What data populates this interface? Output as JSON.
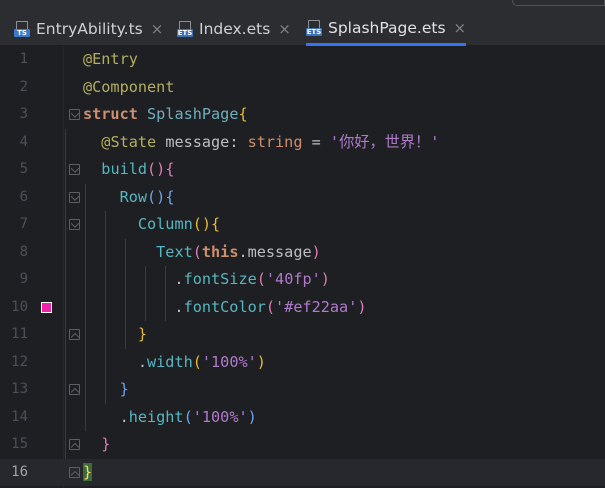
{
  "tabs": [
    {
      "label": "EntryAbility.ts",
      "badge": "TS",
      "badge_class": "ts",
      "active": false
    },
    {
      "label": "Index.ets",
      "badge": "ETS",
      "badge_class": "ets",
      "active": false
    },
    {
      "label": "SplashPage.ets",
      "badge": "ETS",
      "badge_class": "ets",
      "active": true
    }
  ],
  "close_glyph": "×",
  "editor": {
    "current_line": 16,
    "font_color_swatch": "#ef22aa",
    "lines": [
      {
        "n": "1",
        "tokens": [
          [
            "deco",
            "@Entry"
          ]
        ]
      },
      {
        "n": "2",
        "tokens": [
          [
            "deco",
            "@Component"
          ]
        ]
      },
      {
        "n": "3",
        "tokens": [
          [
            "kw",
            "struct"
          ],
          [
            "",
            " "
          ],
          [
            "cls",
            "SplashPage"
          ],
          [
            "br",
            "{"
          ]
        ]
      },
      {
        "n": "4",
        "tokens": [
          [
            "",
            "  "
          ],
          [
            "deco",
            "@State"
          ],
          [
            "",
            " message: "
          ],
          [
            "typ",
            "string"
          ],
          [
            "",
            " = "
          ],
          [
            "str",
            "'你好，世界！'"
          ]
        ]
      },
      {
        "n": "5",
        "tokens": [
          [
            "",
            "  "
          ],
          [
            "fn",
            "build"
          ],
          [
            "br2",
            "()"
          ],
          [
            "br2",
            "{"
          ]
        ]
      },
      {
        "n": "6",
        "tokens": [
          [
            "",
            "    "
          ],
          [
            "fn",
            "Row"
          ],
          [
            "br4",
            "()"
          ],
          [
            "br4",
            "{"
          ]
        ]
      },
      {
        "n": "7",
        "tokens": [
          [
            "",
            "      "
          ],
          [
            "fn",
            "Column"
          ],
          [
            "br",
            "()"
          ],
          [
            "br",
            "{"
          ]
        ]
      },
      {
        "n": "8",
        "tokens": [
          [
            "",
            "        "
          ],
          [
            "fn",
            "Text"
          ],
          [
            "br2",
            "("
          ],
          [
            "kw",
            "this"
          ],
          [
            "",
            ".message"
          ],
          [
            "br2",
            ")"
          ]
        ]
      },
      {
        "n": "9",
        "tokens": [
          [
            "",
            "          ."
          ],
          [
            "fn",
            "fontSize"
          ],
          [
            "br2",
            "("
          ],
          [
            "str",
            "'40fp'"
          ],
          [
            "br2",
            ")"
          ]
        ]
      },
      {
        "n": "10",
        "tokens": [
          [
            "",
            "          ."
          ],
          [
            "fn",
            "fontColor"
          ],
          [
            "br2",
            "("
          ],
          [
            "str",
            "'#ef22aa'"
          ],
          [
            "br2",
            ")"
          ]
        ]
      },
      {
        "n": "11",
        "tokens": [
          [
            "",
            "      "
          ],
          [
            "br",
            "}"
          ]
        ]
      },
      {
        "n": "12",
        "tokens": [
          [
            "",
            "      ."
          ],
          [
            "fn",
            "width"
          ],
          [
            "br",
            "("
          ],
          [
            "str",
            "'100%'"
          ],
          [
            "br",
            ")"
          ]
        ]
      },
      {
        "n": "13",
        "tokens": [
          [
            "",
            "    "
          ],
          [
            "br4",
            "}"
          ]
        ]
      },
      {
        "n": "14",
        "tokens": [
          [
            "",
            "    ."
          ],
          [
            "fn",
            "height"
          ],
          [
            "br4",
            "("
          ],
          [
            "str",
            "'100%'"
          ],
          [
            "br4",
            ")"
          ]
        ]
      },
      {
        "n": "15",
        "tokens": [
          [
            "",
            "  "
          ],
          [
            "br2",
            "}"
          ]
        ]
      },
      {
        "n": "16",
        "tokens": [
          [
            "brm",
            "}"
          ]
        ]
      }
    ]
  }
}
